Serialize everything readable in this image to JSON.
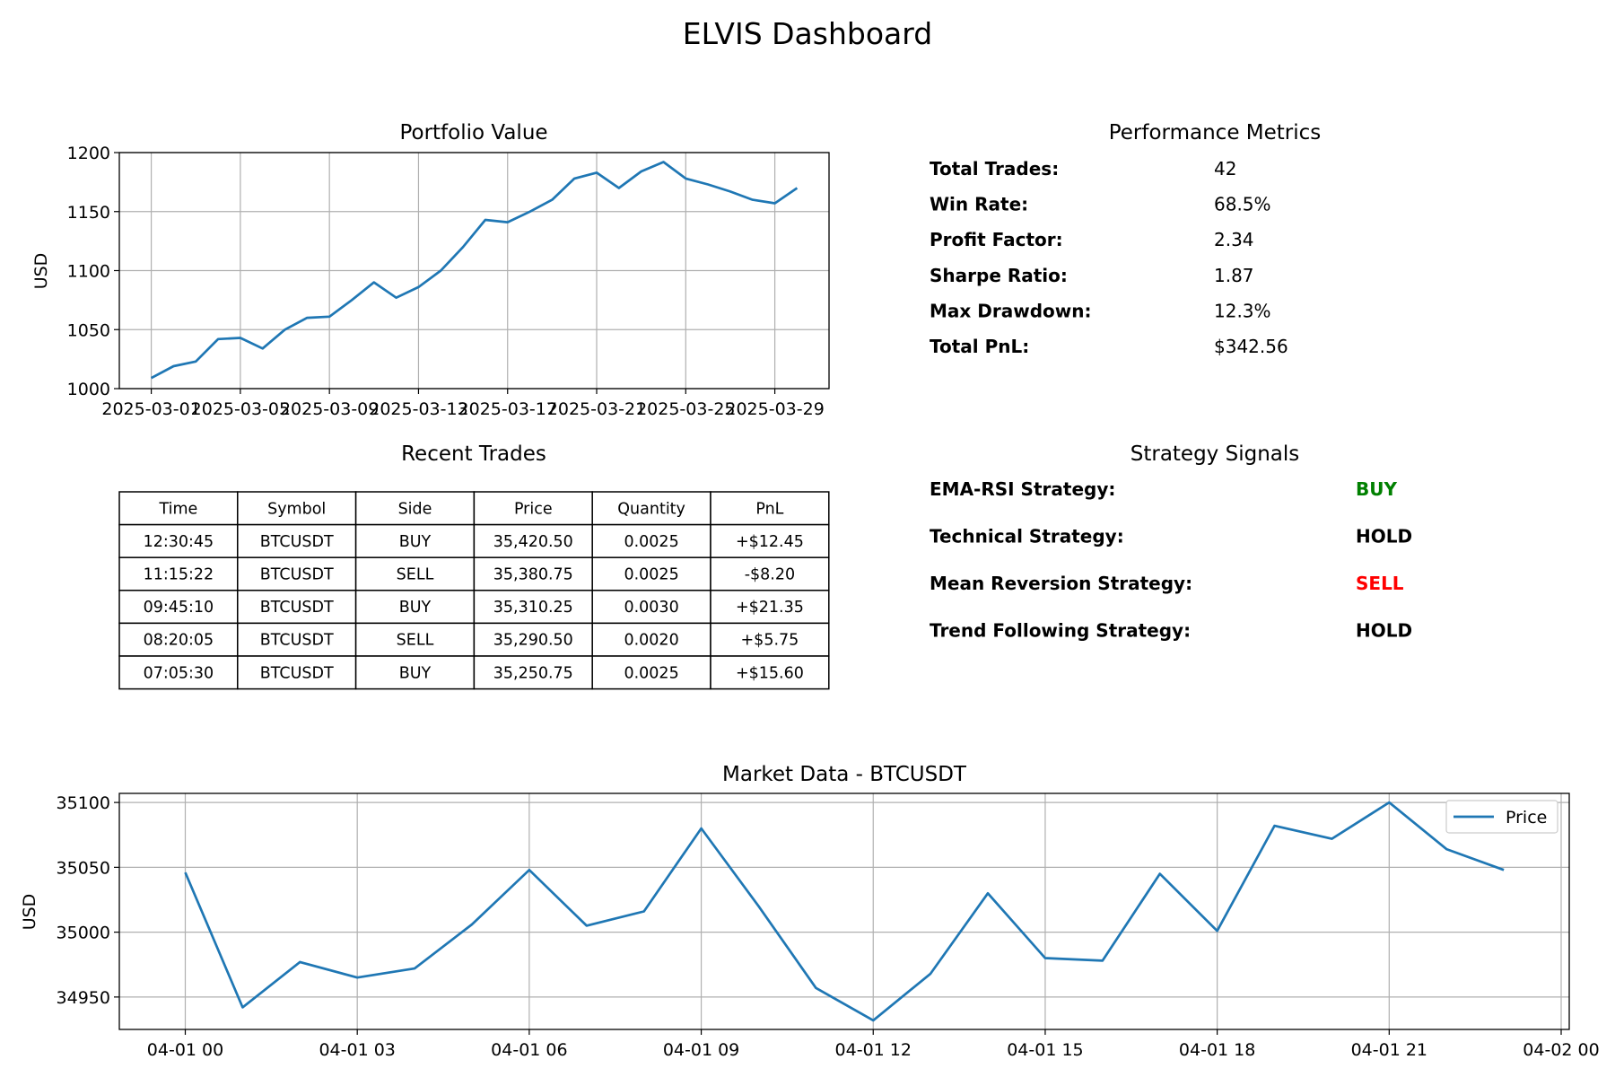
{
  "title": "ELVIS Dashboard",
  "portfolio": {
    "title": "Portfolio Value",
    "ylabel": "USD",
    "tick_labels": [
      "2025-03-01",
      "2025-03-05",
      "2025-03-09",
      "2025-03-13",
      "2025-03-17",
      "2025-03-21",
      "2025-03-25",
      "2025-03-29"
    ],
    "yticks": [
      "1000",
      "1050",
      "1100",
      "1150",
      "1200"
    ]
  },
  "metrics": {
    "title": "Performance Metrics",
    "rows": [
      {
        "label": "Total Trades:",
        "value": "42"
      },
      {
        "label": "Win Rate:",
        "value": "68.5%"
      },
      {
        "label": "Profit Factor:",
        "value": "2.34"
      },
      {
        "label": "Sharpe Ratio:",
        "value": "1.87"
      },
      {
        "label": "Max Drawdown:",
        "value": "12.3%"
      },
      {
        "label": "Total PnL:",
        "value": "$342.56"
      }
    ]
  },
  "trades": {
    "title": "Recent Trades",
    "headers": [
      "Time",
      "Symbol",
      "Side",
      "Price",
      "Quantity",
      "PnL"
    ],
    "rows": [
      [
        "12:30:45",
        "BTCUSDT",
        "BUY",
        "35,420.50",
        "0.0025",
        "+$12.45"
      ],
      [
        "11:15:22",
        "BTCUSDT",
        "SELL",
        "35,380.75",
        "0.0025",
        "-$8.20"
      ],
      [
        "09:45:10",
        "BTCUSDT",
        "BUY",
        "35,310.25",
        "0.0030",
        "+$21.35"
      ],
      [
        "08:20:05",
        "BTCUSDT",
        "SELL",
        "35,290.50",
        "0.0020",
        "+$5.75"
      ],
      [
        "07:05:30",
        "BTCUSDT",
        "BUY",
        "35,250.75",
        "0.0025",
        "+$15.60"
      ]
    ]
  },
  "signals": {
    "title": "Strategy Signals",
    "rows": [
      {
        "label": "EMA-RSI Strategy:",
        "value": "BUY",
        "color": "#008000"
      },
      {
        "label": "Technical Strategy:",
        "value": "HOLD",
        "color": "#000000"
      },
      {
        "label": "Mean Reversion Strategy:",
        "value": "SELL",
        "color": "#ff0000"
      },
      {
        "label": "Trend Following Strategy:",
        "value": "HOLD",
        "color": "#000000"
      }
    ]
  },
  "market": {
    "title": "Market Data - BTCUSDT",
    "ylabel": "USD",
    "legend": "Price",
    "tick_labels": [
      "04-01 00",
      "04-01 03",
      "04-01 06",
      "04-01 09",
      "04-01 12",
      "04-01 15",
      "04-01 18",
      "04-01 21",
      "04-02 00"
    ],
    "yticks": [
      "34950",
      "35000",
      "35050",
      "35100"
    ]
  },
  "chart_data": [
    {
      "type": "line",
      "title": "Portfolio Value",
      "xlabel": "",
      "ylabel": "USD",
      "x": [
        "2025-03-01",
        "2025-03-02",
        "2025-03-03",
        "2025-03-04",
        "2025-03-05",
        "2025-03-06",
        "2025-03-07",
        "2025-03-08",
        "2025-03-09",
        "2025-03-10",
        "2025-03-11",
        "2025-03-12",
        "2025-03-13",
        "2025-03-14",
        "2025-03-15",
        "2025-03-16",
        "2025-03-17",
        "2025-03-18",
        "2025-03-19",
        "2025-03-20",
        "2025-03-21",
        "2025-03-22",
        "2025-03-23",
        "2025-03-24",
        "2025-03-25",
        "2025-03-26",
        "2025-03-27",
        "2025-03-28",
        "2025-03-29",
        "2025-03-30"
      ],
      "values": [
        1009,
        1019,
        1023,
        1042,
        1043,
        1034,
        1050,
        1060,
        1061,
        1075,
        1090,
        1077,
        1086,
        1100,
        1120,
        1143,
        1141,
        1150,
        1160,
        1178,
        1183,
        1170,
        1184,
        1192,
        1178,
        1173,
        1167,
        1160,
        1157,
        1170
      ],
      "ylim": [
        1000,
        1200
      ],
      "grid": true,
      "color": "#1f77b4"
    },
    {
      "type": "line",
      "title": "Market Data - BTCUSDT",
      "xlabel": "",
      "ylabel": "USD",
      "x": [
        "04-01 00:00",
        "04-01 01:00",
        "04-01 02:00",
        "04-01 03:00",
        "04-01 04:00",
        "04-01 05:00",
        "04-01 06:00",
        "04-01 07:00",
        "04-01 08:00",
        "04-01 09:00",
        "04-01 10:00",
        "04-01 11:00",
        "04-01 12:00",
        "04-01 13:00",
        "04-01 14:00",
        "04-01 15:00",
        "04-01 16:00",
        "04-01 17:00",
        "04-01 18:00",
        "04-01 19:00",
        "04-01 20:00",
        "04-01 21:00",
        "04-01 22:00",
        "04-01 23:00"
      ],
      "series": [
        {
          "name": "Price",
          "values": [
            35046,
            34942,
            34977,
            34965,
            34972,
            35006,
            35048,
            35005,
            35016,
            35080,
            35020,
            34957,
            34932,
            34968,
            35030,
            34980,
            34978,
            35045,
            35001,
            35082,
            35072,
            35100,
            35064,
            35048
          ]
        }
      ],
      "ylim": [
        34925,
        35107
      ],
      "grid": true,
      "legend": "top-right",
      "color": "#1f77b4"
    }
  ]
}
